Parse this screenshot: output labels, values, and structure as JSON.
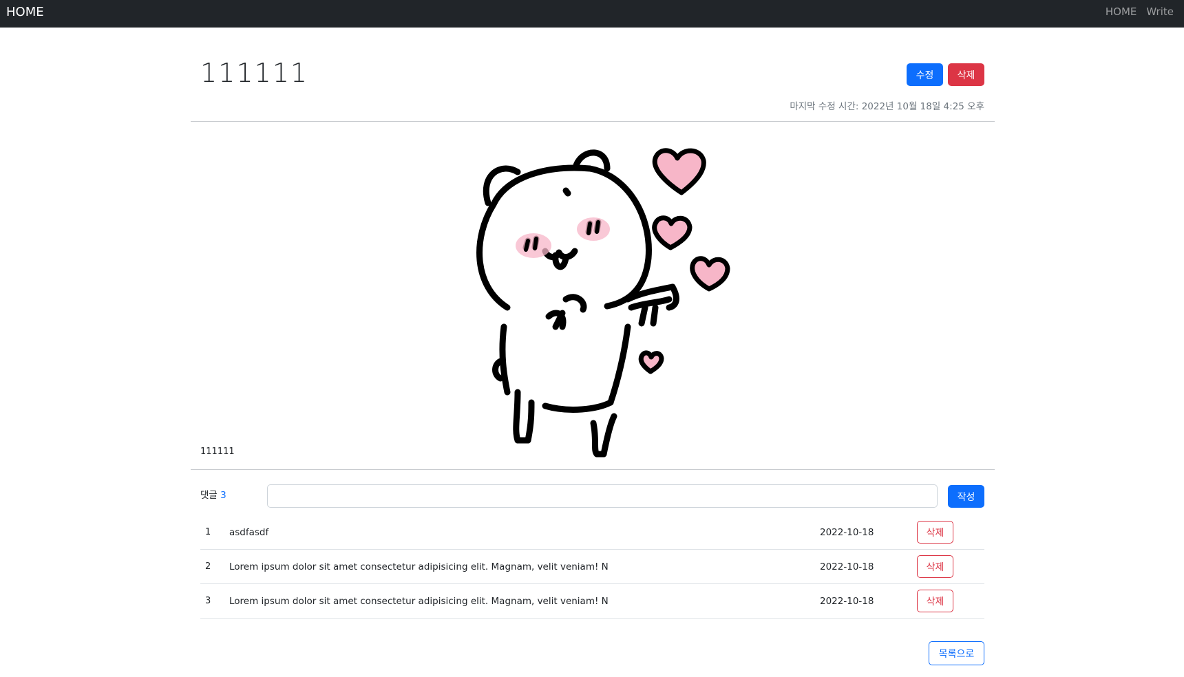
{
  "nav": {
    "brand": "HOME",
    "links": [
      "HOME",
      "Write"
    ]
  },
  "post": {
    "title": "111111",
    "edit_label": "수정",
    "delete_label": "삭제",
    "last_modified": "마지막 수정 시간: 2022년 10월 18일 4:25 오후",
    "body": "111111"
  },
  "comments": {
    "label": "댓글",
    "count": "3",
    "input_value": "",
    "submit_label": "작성",
    "items": [
      {
        "num": "1",
        "text": "asdfasdf",
        "date": "2022-10-18",
        "delete_label": "삭제"
      },
      {
        "num": "2",
        "text": "Lorem ipsum dolor sit amet consectetur adipisicing elit. Magnam, velit veniam! N",
        "date": "2022-10-18",
        "delete_label": "삭제"
      },
      {
        "num": "3",
        "text": "Lorem ipsum dolor sit amet consectetur adipisicing elit. Magnam, velit veniam! N",
        "date": "2022-10-18",
        "delete_label": "삭제"
      }
    ]
  },
  "back_label": "목록으로",
  "colors": {
    "navbar": "#212529",
    "primary": "#0d6efd",
    "danger": "#dc3545",
    "heart": "#f7b6c8"
  }
}
